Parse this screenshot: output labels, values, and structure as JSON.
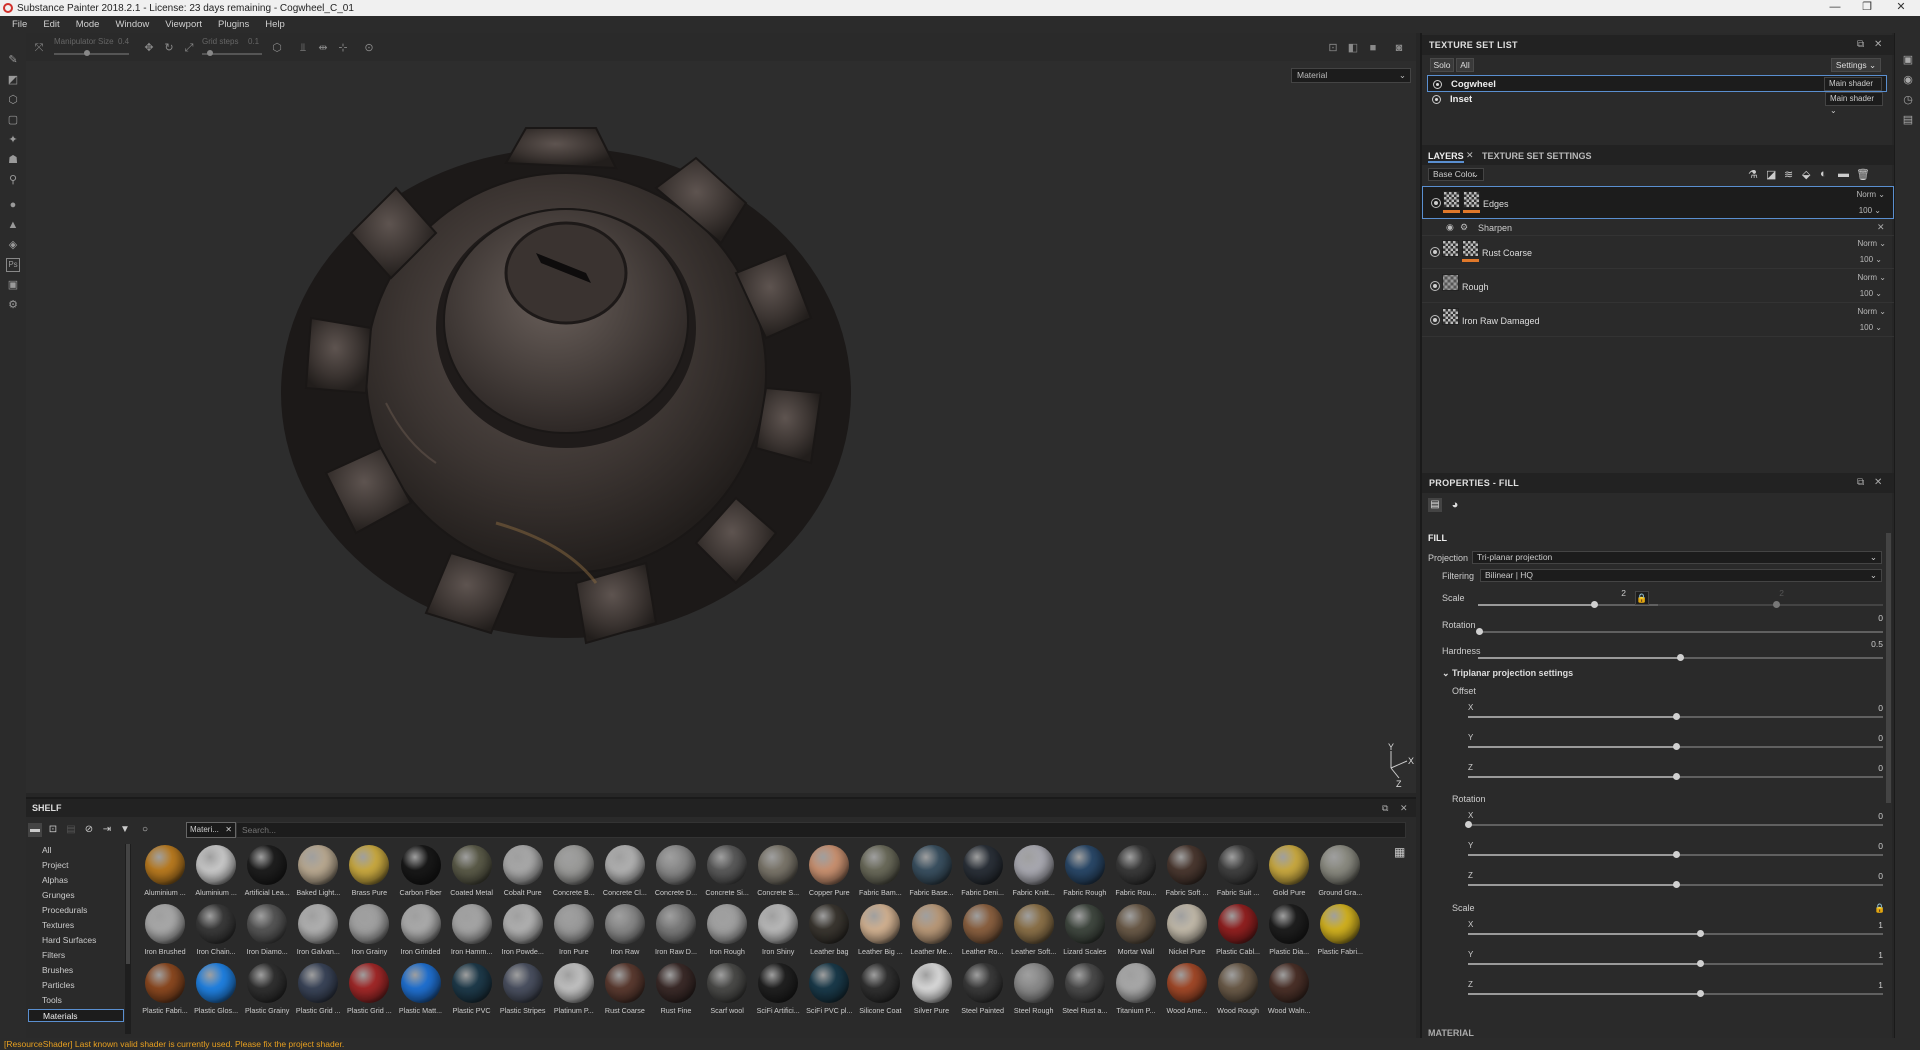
{
  "titlebar": {
    "title": "Substance Painter 2018.2.1 - License: 23 days remaining - Cogwheel_C_01",
    "minimize": "—",
    "maximize": "❐",
    "close": "✕"
  },
  "menu": [
    "File",
    "Edit",
    "Mode",
    "Window",
    "Viewport",
    "Plugins",
    "Help"
  ],
  "viewport_toolbar": {
    "manipulator_size_label": "Manipulator Size",
    "manipulator_size_value": "0.4",
    "grid_steps_label": "Grid steps",
    "grid_steps_value": "0.1"
  },
  "viewport": {
    "display_mode": "Material",
    "gizmo_y": "Y",
    "gizmo_x": "X",
    "gizmo_z": "Z"
  },
  "texture_set_list": {
    "title": "TEXTURE SET LIST",
    "solo": "Solo",
    "all": "All",
    "settings": "Settings",
    "sets": [
      {
        "name": "Cogwheel",
        "shader": "Main shader"
      },
      {
        "name": "Inset",
        "shader": "Main shader"
      }
    ]
  },
  "layers": {
    "tab_layers": "LAYERS",
    "tab_settings": "TEXTURE SET SETTINGS",
    "channel": "Base Color",
    "items": [
      {
        "name": "Edges",
        "blend": "Norm",
        "opacity": "100"
      },
      {
        "name": "Sharpen"
      },
      {
        "name": "Rust Coarse",
        "blend": "Norm",
        "opacity": "100"
      },
      {
        "name": "Rough",
        "blend": "Norm",
        "opacity": "100"
      },
      {
        "name": "Iron Raw Damaged",
        "blend": "Norm",
        "opacity": "100"
      }
    ]
  },
  "properties": {
    "title": "PROPERTIES - FILL",
    "section": "FILL",
    "projection_label": "Projection",
    "projection_value": "Tri-planar projection",
    "filtering_label": "Filtering",
    "filtering_value": "Bilinear | HQ",
    "scale_label": "Scale",
    "scale_value": "2",
    "scale_value_2": "2",
    "rotation_label": "Rotation",
    "rotation_value": "0",
    "hardness_label": "Hardness",
    "hardness_value": "0.5",
    "triplanar_title": "Triplanar projection settings",
    "offset_label": "Offset",
    "rot_label": "Rotation",
    "scale2_label": "Scale",
    "axes": [
      "X",
      "Y",
      "Z"
    ],
    "offset_values": [
      "0",
      "0",
      "0"
    ],
    "rotation_values": [
      "0",
      "0",
      "0"
    ],
    "scale_values": [
      "1",
      "1",
      "1"
    ],
    "material_section": "MATERIAL"
  },
  "shelf": {
    "title": "SHELF",
    "filter_tag": "Materi...",
    "search_placeholder": "Search...",
    "categories": [
      "All",
      "Project",
      "Alphas",
      "Grunges",
      "Procedurals",
      "Textures",
      "Hard Surfaces",
      "Filters",
      "Brushes",
      "Particles",
      "Tools",
      "Materials"
    ],
    "materials": [
      {
        "name": "Aluminium ...",
        "color": "#b87a20"
      },
      {
        "name": "Aluminium ...",
        "color": "#c8c8c8"
      },
      {
        "name": "Artificial Lea...",
        "color": "#1e1e1e"
      },
      {
        "name": "Baked Light...",
        "color": "#b8a890"
      },
      {
        "name": "Brass Pure",
        "color": "#c8a840"
      },
      {
        "name": "Carbon Fiber",
        "color": "#181818"
      },
      {
        "name": "Coated Metal",
        "color": "#5a5a48"
      },
      {
        "name": "Cobalt Pure",
        "color": "#a8a8a8"
      },
      {
        "name": "Concrete B...",
        "color": "#9a9a98"
      },
      {
        "name": "Concrete Cl...",
        "color": "#b0b0b0"
      },
      {
        "name": "Concrete D...",
        "color": "#8a8a8a"
      },
      {
        "name": "Concrete Si...",
        "color": "#5a5a5a"
      },
      {
        "name": "Concrete S...",
        "color": "#7a756a"
      },
      {
        "name": "Copper Pure",
        "color": "#c89070"
      },
      {
        "name": "Fabric Bam...",
        "color": "#6a6a5a"
      },
      {
        "name": "Fabric Base...",
        "color": "#3a5060"
      },
      {
        "name": "Fabric Deni...",
        "color": "#2a3038"
      },
      {
        "name": "Fabric Knitt...",
        "color": "#a8a8b0"
      },
      {
        "name": "Fabric Rough",
        "color": "#2a4868"
      },
      {
        "name": "Fabric Rou...",
        "color": "#3a3a3a"
      },
      {
        "name": "Fabric Soft ...",
        "color": "#4a3830"
      },
      {
        "name": "Fabric Suit ...",
        "color": "#404040"
      },
      {
        "name": "Gold Pure",
        "color": "#c8a840"
      },
      {
        "name": "Ground Gra...",
        "color": "#8a8a80"
      },
      {
        "name": "Iron Brushed",
        "color": "#a8a8a8"
      },
      {
        "name": "Iron Chain...",
        "color": "#3a3a3a"
      },
      {
        "name": "Iron Diamo...",
        "color": "#555555"
      },
      {
        "name": "Iron Galvan...",
        "color": "#b0b0b0"
      },
      {
        "name": "Iron Grainy",
        "color": "#a0a0a0"
      },
      {
        "name": "Iron Grinded",
        "color": "#aaaaaa"
      },
      {
        "name": "Iron Hamm...",
        "color": "#a4a4a4"
      },
      {
        "name": "Iron Powde...",
        "color": "#b0b0b0"
      },
      {
        "name": "Iron Pure",
        "color": "#9a9a9a"
      },
      {
        "name": "Iron Raw",
        "color": "#888888"
      },
      {
        "name": "Iron Raw D...",
        "color": "#7a7a7a"
      },
      {
        "name": "Iron Rough",
        "color": "#a0a0a0"
      },
      {
        "name": "Iron Shiny",
        "color": "#b8b8b8"
      },
      {
        "name": "Leather bag",
        "color": "#3a3630"
      },
      {
        "name": "Leather Big ...",
        "color": "#d0b090"
      },
      {
        "name": "Leather Me...",
        "color": "#b89878"
      },
      {
        "name": "Leather Ro...",
        "color": "#8a6040"
      },
      {
        "name": "Leather Soft...",
        "color": "#8a7048"
      },
      {
        "name": "Lizard Scales",
        "color": "#404840"
      },
      {
        "name": "Mortar Wall",
        "color": "#6a5a48"
      },
      {
        "name": "Nickel Pure",
        "color": "#c0b8a8"
      },
      {
        "name": "Plastic Cabl...",
        "color": "#902020"
      },
      {
        "name": "Plastic Dia...",
        "color": "#1e1e1e"
      },
      {
        "name": "Plastic Fabri...",
        "color": "#d0b020"
      },
      {
        "name": "Plastic Fabri...",
        "color": "#8a4820"
      },
      {
        "name": "Plastic Glos...",
        "color": "#2080e0"
      },
      {
        "name": "Plastic Grainy",
        "color": "#303030"
      },
      {
        "name": "Plastic Grid ...",
        "color": "#3a4458"
      },
      {
        "name": "Plastic Grid ...",
        "color": "#a02828"
      },
      {
        "name": "Plastic Matt...",
        "color": "#2070d0"
      },
      {
        "name": "Plastic PVC",
        "color": "#1e3a4a"
      },
      {
        "name": "Plastic Stripes",
        "color": "#4a5060"
      },
      {
        "name": "Platinum P...",
        "color": "#c0c0c0"
      },
      {
        "name": "Rust Coarse",
        "color": "#5a3a30"
      },
      {
        "name": "Rust Fine",
        "color": "#3a2a28"
      },
      {
        "name": "Scarf wool",
        "color": "#4a4a48"
      },
      {
        "name": "SciFi Artifici...",
        "color": "#202020"
      },
      {
        "name": "SciFi PVC pl...",
        "color": "#1a3a4a"
      },
      {
        "name": "Silicone Coat",
        "color": "#303030"
      },
      {
        "name": "Silver Pure",
        "color": "#d8d8d8"
      },
      {
        "name": "Steel Painted",
        "color": "#3a3a3a"
      },
      {
        "name": "Steel Rough",
        "color": "#8a8a8a"
      },
      {
        "name": "Steel Rust a...",
        "color": "#4a4a4a"
      },
      {
        "name": "Titanium P...",
        "color": "#a8a8a8"
      },
      {
        "name": "Wood Ame...",
        "color": "#a04828"
      },
      {
        "name": "Wood Rough",
        "color": "#6a5a48"
      },
      {
        "name": "Wood Waln...",
        "color": "#4a3028"
      }
    ]
  },
  "status": "[ResourceShader] Last known valid shader is currently used. Please fix the project shader.",
  "colors": {
    "accent": "#e0782a",
    "selection": "#5a8fd0",
    "warning": "#e8a020"
  }
}
